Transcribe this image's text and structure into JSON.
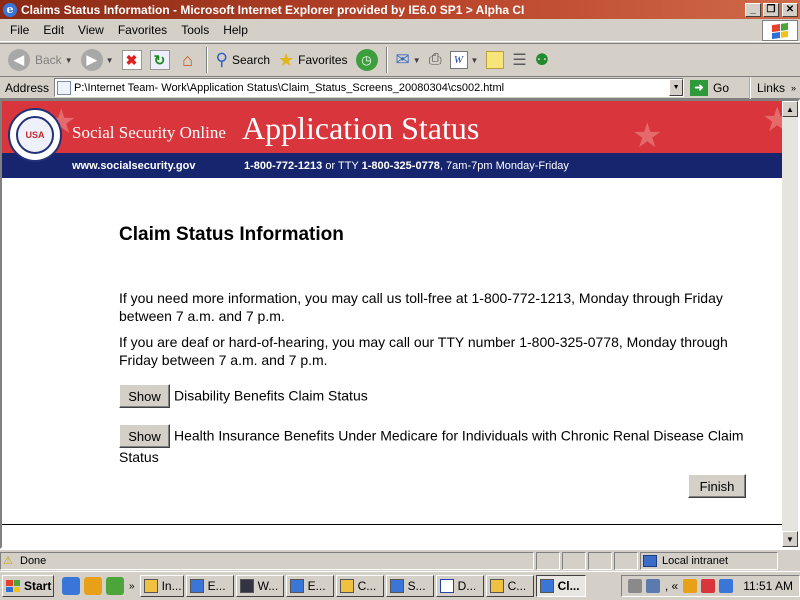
{
  "window": {
    "title": "Claims Status Information - Microsoft Internet Explorer provided by IE6.0 SP1 > Alpha CI",
    "minimize": "_",
    "maximize": "❐",
    "close": "✕"
  },
  "menu": [
    "File",
    "Edit",
    "View",
    "Favorites",
    "Tools",
    "Help"
  ],
  "toolbar": {
    "back_label": "Back",
    "search_label": "Search",
    "favorites_label": "Favorites"
  },
  "address": {
    "label": "Address",
    "url": "P:\\Internet Team- Work\\Application Status\\Claim_Status_Screens_20080304\\cs002.html",
    "go_label": "Go",
    "links_label": "Links"
  },
  "banner": {
    "site_name": "Social Security Online",
    "section_title": "Application Status",
    "site_url": "www.socialsecurity.gov",
    "phone": "1-800-772-1213",
    "tty_prefix": "or TTY",
    "tty": "1-800-325-0778",
    "hours": ", 7am-7pm Monday-Friday",
    "seal_text": "USA"
  },
  "page": {
    "heading": "Claim Status Information",
    "para1": "If you need more information, you may call us toll-free at 1-800-772-1213, Monday through Friday between 7 a.m. and 7 p.m.",
    "para2": "If you are deaf or hard-of-hearing, you may call our TTY number 1-800-325-0778, Monday through Friday between 7 a.m. and 7 p.m.",
    "items": [
      {
        "button": "Show",
        "label": "Disability Benefits Claim Status"
      },
      {
        "button": "Show",
        "label": "Health Insurance Benefits Under Medicare for Individuals with Chronic Renal Disease Claim Status"
      }
    ],
    "finish_label": "Finish"
  },
  "status": {
    "text": "Done",
    "zone": "Local intranet"
  },
  "taskbar": {
    "start_label": "Start",
    "tasks": [
      "In...",
      "E...",
      "W...",
      "E...",
      "C...",
      "S...",
      "D...",
      "C...",
      "Cl..."
    ],
    "tray_extra": ", «",
    "clock": "11:51 AM"
  },
  "colors": {
    "banner_red": "#d8363c",
    "banner_blue": "#16256e",
    "titlebar": "#8a2a14"
  }
}
